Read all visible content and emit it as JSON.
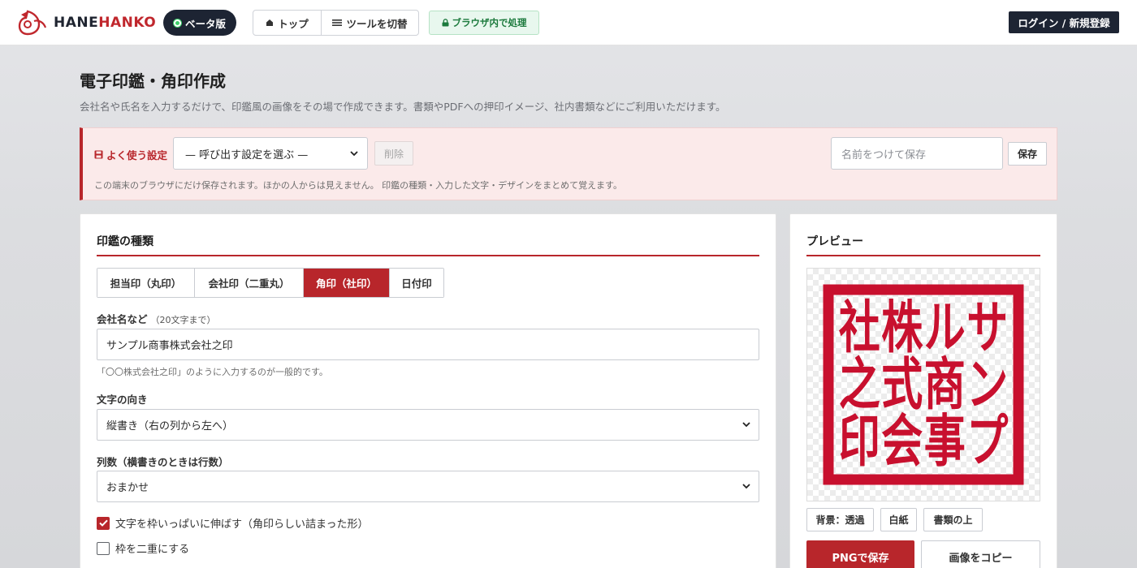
{
  "header": {
    "brand_left": "HANE",
    "brand_right": "HANKO",
    "beta_label": "ベータ版",
    "nav": {
      "top_label": "トップ",
      "switch_label": "ツールを切替"
    },
    "secure_label": "ブラウザ内で処理",
    "login_label": "ログイン / 新規登録"
  },
  "page": {
    "title": "電子印鑑・角印作成",
    "description": "会社名や氏名を入力するだけで、印鑑風の画像をその場で作成できます。書類やPDFへの押印イメージ、社内書類などにご利用いただけます。"
  },
  "preset": {
    "label": "よく使う設定",
    "select_value": "— 呼び出す設定を選ぶ —",
    "delete_label": "削除",
    "name_placeholder": "名前をつけて保存",
    "save_label": "保存",
    "note": "この端末のブラウザにだけ保存されます。ほかの人からは見えません。 印鑑の種類・入力した文字・デザインをまとめて覚えます。"
  },
  "form": {
    "section_title": "印鑑の種類",
    "tabs": [
      {
        "label": "担当印（丸印）",
        "active": false
      },
      {
        "label": "会社印（二重丸）",
        "active": false
      },
      {
        "label": "角印（社印）",
        "active": true
      },
      {
        "label": "日付印",
        "active": false
      }
    ],
    "name_label": "会社名など",
    "name_limit": "（20文字まで）",
    "name_value": "サンプル商事株式会社之印",
    "name_hint": "「〇〇株式会社之印」のように入力するのが一般的です。",
    "direction_label": "文字の向き",
    "direction_value": "縦書き（右の列から左へ）",
    "columns_label": "列数（横書きのときは行数）",
    "columns_value": "おまかせ",
    "check_stretch": {
      "label": "文字を枠いっぱいに伸ばす（角印らしい詰まった形）",
      "checked": true
    },
    "check_double": {
      "label": "枠を二重にする",
      "checked": false
    }
  },
  "preview": {
    "title": "プレビュー",
    "stamp_color": "#c8102e",
    "stamp_columns": [
      "社之印",
      "株式会",
      "ル商事",
      "サンプ"
    ],
    "bg_options": [
      "背景：透過",
      "白紙",
      "書類の上"
    ],
    "png_label": "PNGで保存",
    "copy_label": "画像をコピー"
  },
  "colors": {
    "accent": "#b8262b",
    "dark": "#1d2433",
    "secure_green": "#1c7a3d"
  }
}
